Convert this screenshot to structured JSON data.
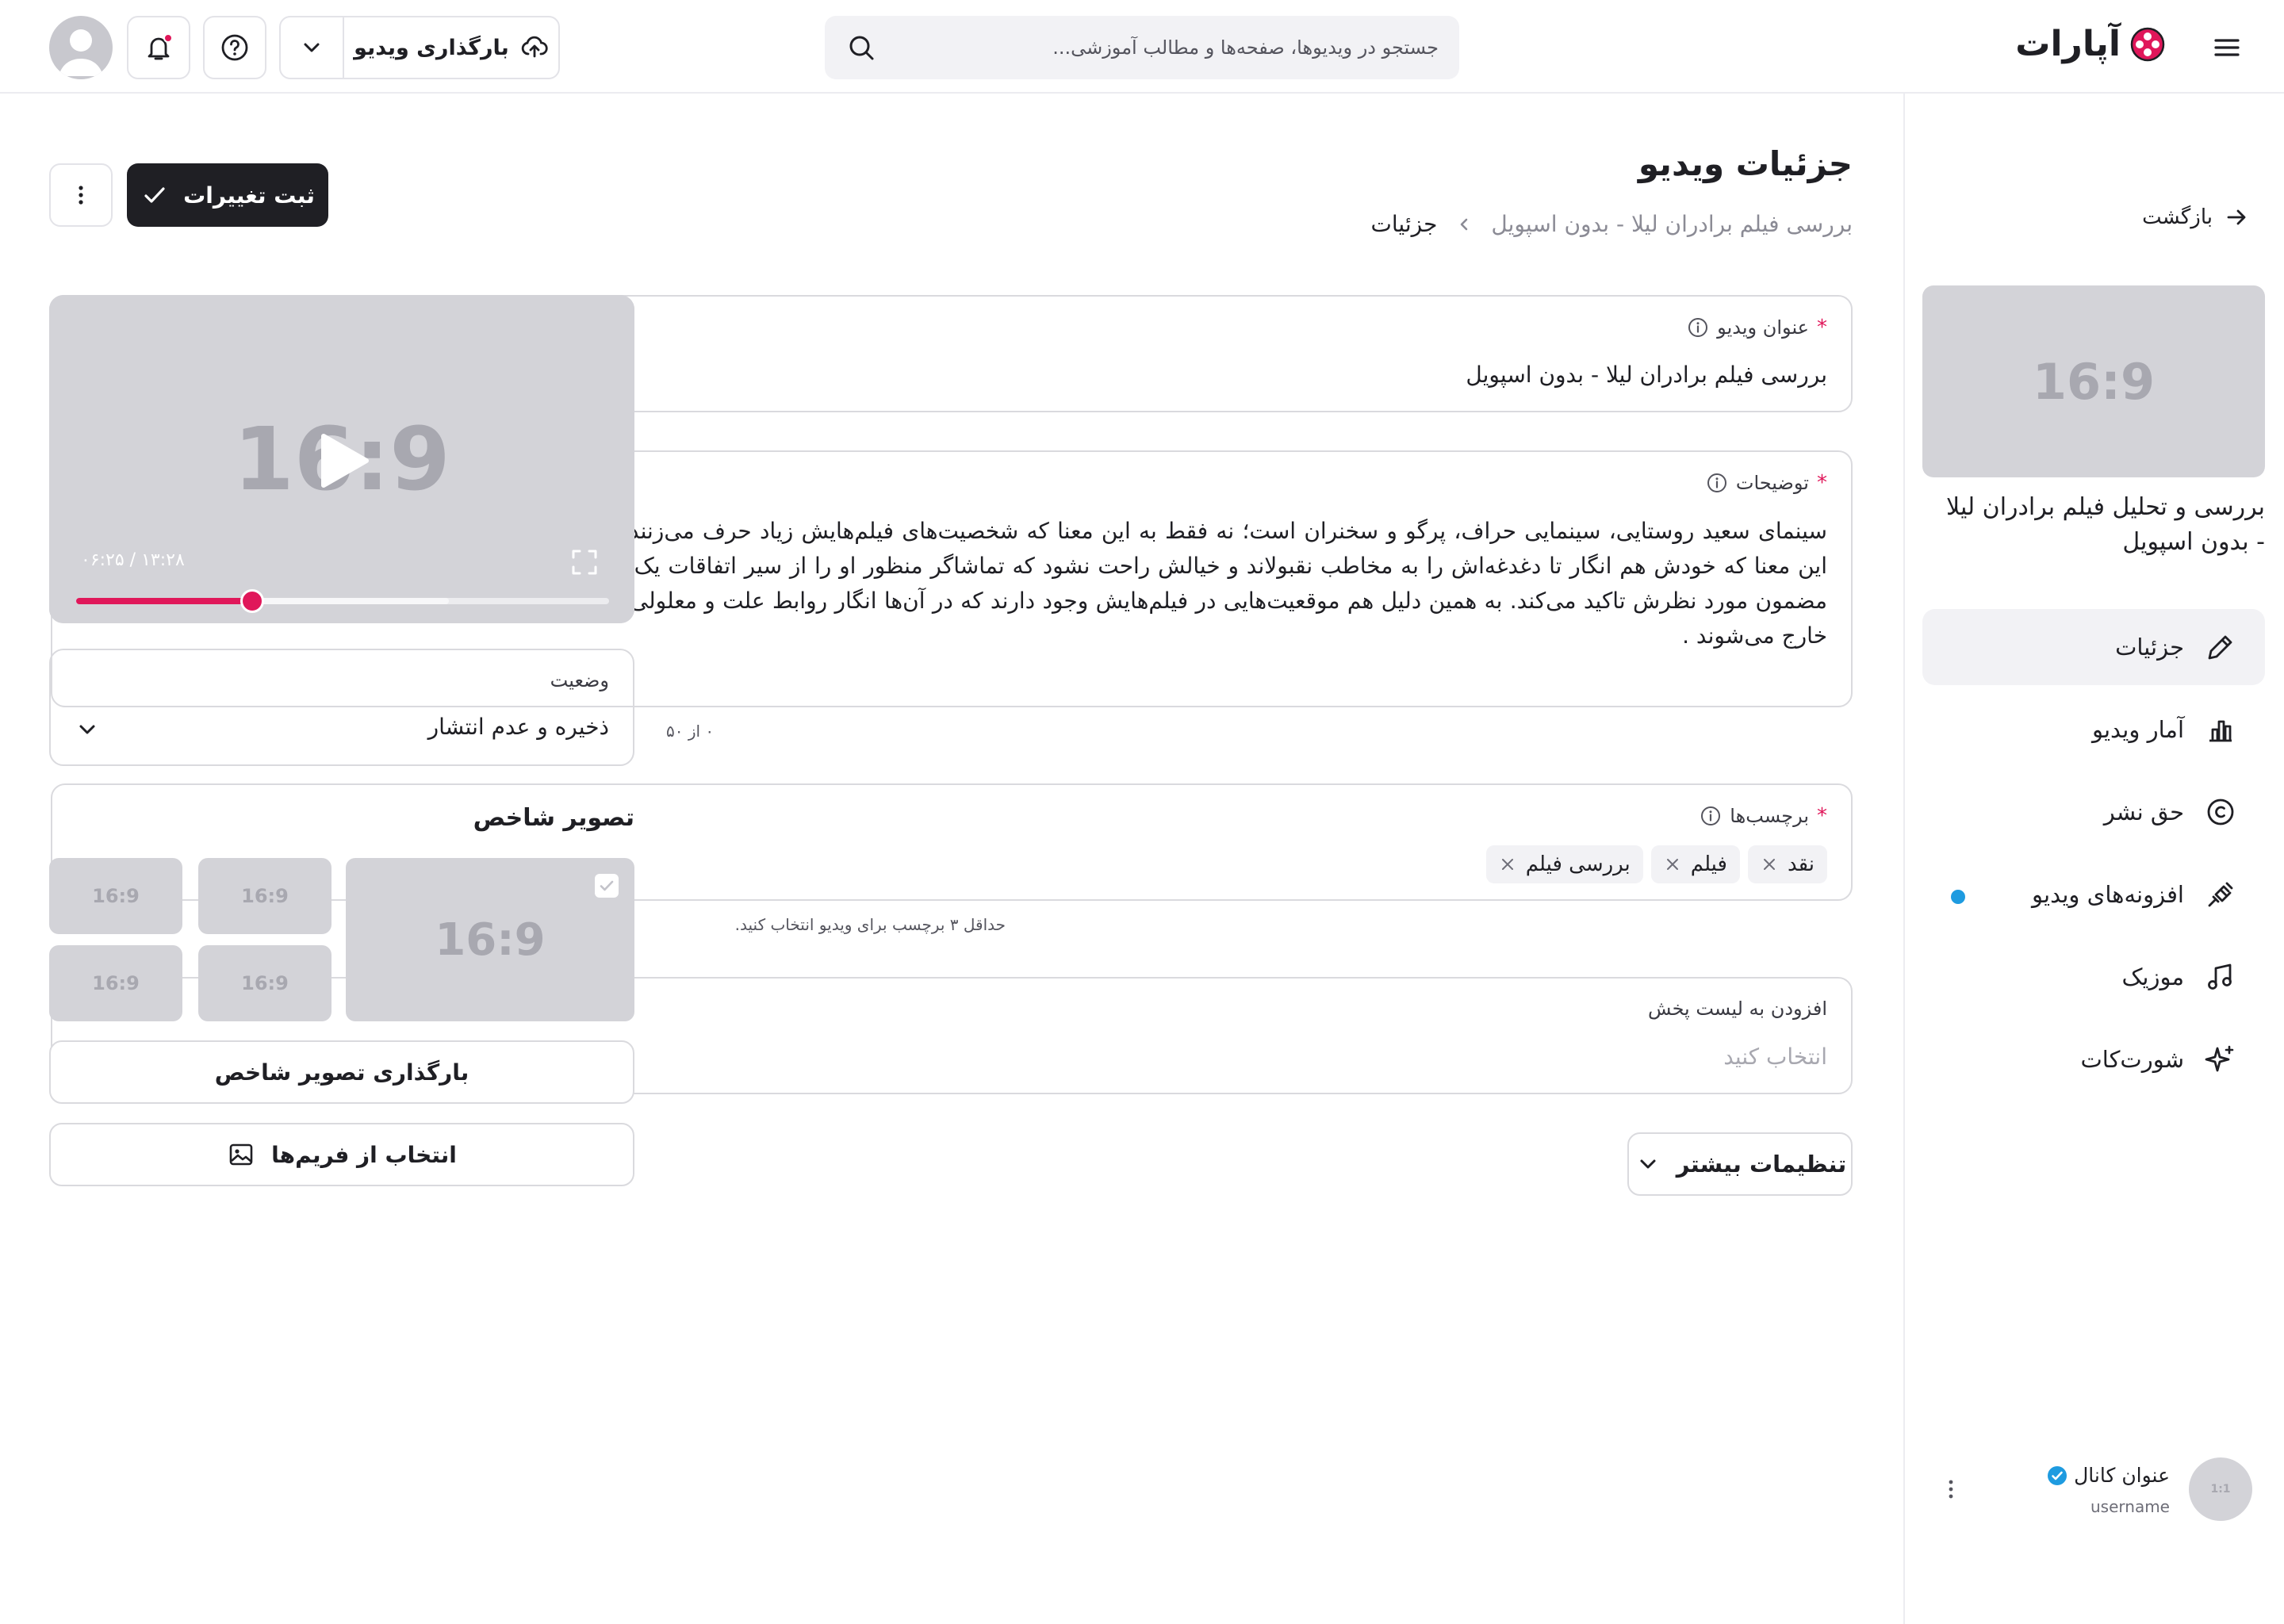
{
  "header": {
    "logo_text": "آپارات",
    "search_placeholder": "جستجو در ویدیوها، صفحه‌ها و مطالب آموزشی...",
    "upload_label": "بارگذاری ویدیو"
  },
  "sidebar": {
    "back_label": "بازگشت",
    "thumb_ratio": "16:9",
    "video_title": "بررسی و تحلیل فیلم برادران لیلا - بدون اسپویل",
    "nav": [
      {
        "label": "جزئیات",
        "icon": "pencil-icon",
        "active": true
      },
      {
        "label": "آمار ویدیو",
        "icon": "bar-chart-icon",
        "active": false
      },
      {
        "label": "حق نشر",
        "icon": "copyright-icon",
        "active": false
      },
      {
        "label": "افزونه‌های ویدیو",
        "icon": "plugin-icon",
        "active": false,
        "badge": true
      },
      {
        "label": "موزیک",
        "icon": "music-icon",
        "active": false
      },
      {
        "label": "شورت‌کات",
        "icon": "sparkle-icon",
        "active": false
      }
    ],
    "channel": {
      "name": "عنوان کانال",
      "username": "username",
      "avatar_ratio": "1:1"
    }
  },
  "page": {
    "title": "جزئیات ویدیو",
    "breadcrumb_parent": "بررسی فیلم برادران لیلا - بدون اسپویل",
    "breadcrumb_current": "جزئیات",
    "save_label": "ثبت تغییرات"
  },
  "form": {
    "title_label": "عنوان ویدیو",
    "title_value": "بررسی فیلم برادران لیلا - بدون اسپویل",
    "desc_label": "توضیحات",
    "desc_value": "سینمای سعید روستایی، سینمایی حراف، پرگو و سخنران است؛ نه فقط به این معنا که شخصیت‌های فیلم‌هایش زیاد حرف می‌زنند، جر و بحث می‌کنند یا مدام توی حرف هم می‌پرند، بلکه به این معنا که خودش هم انگار تا دغدغه‌اش را به مخاطب نقبولاند و خیالش راحت نشود که تماشاگر منظور او را از سیر اتفاقات یک بخش یا یک سکانس فهمیده، دست‌بردار نیست و مدام روی مضمون مورد نظرش تاکید می‌کند. به همین دلیل هم موقعیت‌هایی در فیلم‌هایش وجود دارند که در آن‌ها انگار روابط علت و معلولی داستان و هم‌چنین بده و بستان شخصیت‌ها از حالت ارگانیک خارج می‌شوند .",
    "desc_counter": "۰ از ۵۰",
    "tags_label": "برچسب‌ها",
    "tags": [
      "نقد",
      "فیلم",
      "بررسی فیلم"
    ],
    "tags_helper": "حداقل ۳ برچسب برای ویدیو انتخاب کنید.",
    "playlist_label": "افزودن به لیست پخش",
    "playlist_placeholder": "انتخاب کنید",
    "more_settings_label": "تنظیمات بیشتر"
  },
  "player": {
    "ratio": "16:9",
    "time": "۱۳:۲۸ / ۰۶:۲۵",
    "progress": 0.33,
    "buffered": 0.7
  },
  "status": {
    "label": "وضعیت",
    "value": "ذخیره و عدم انتشار"
  },
  "cover": {
    "title": "تصویر شاخص",
    "thumb_ratio": "16:9",
    "upload_label": "بارگذاری تصویر شاخص",
    "frames_label": "انتخاب از فریم‌ها"
  },
  "colors": {
    "accent": "#e0175a",
    "dark": "#1f1f24",
    "badge": "#1e9be0",
    "placeholder": "#d3d3d8"
  }
}
